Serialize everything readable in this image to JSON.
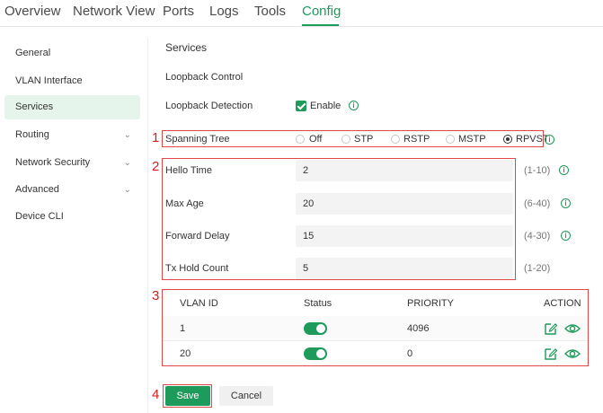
{
  "topnav": {
    "tabs": [
      {
        "label": "Overview"
      },
      {
        "label": "Network View"
      },
      {
        "label": "Ports"
      },
      {
        "label": "Logs"
      },
      {
        "label": "Tools"
      },
      {
        "label": "Config"
      }
    ],
    "active_tab": "Config"
  },
  "sidebar": {
    "items": [
      {
        "label": "General"
      },
      {
        "label": "VLAN Interface"
      },
      {
        "label": "Services"
      },
      {
        "label": "Routing"
      },
      {
        "label": "Network Security"
      },
      {
        "label": "Advanced"
      },
      {
        "label": "Device CLI"
      }
    ],
    "active_item": "Services",
    "expand_icon": "chevron-down-icon"
  },
  "main": {
    "title": "Services",
    "section_title": "Loopback Control",
    "loopback": {
      "label": "Loopback Detection",
      "checkbox_label": "Enable",
      "checked": true
    },
    "spanning_tree": {
      "label": "Spanning Tree",
      "options": [
        "Off",
        "STP",
        "RSTP",
        "MSTP",
        "RPVST"
      ],
      "selected": "RPVST"
    },
    "params": [
      {
        "label": "Hello Time",
        "value": "2",
        "range": "(1-10)",
        "info": true
      },
      {
        "label": "Max Age",
        "value": "20",
        "range": "(6-40)",
        "info": true
      },
      {
        "label": "Forward Delay",
        "value": "15",
        "range": "(4-30)",
        "info": true
      },
      {
        "label": "Tx Hold Count",
        "value": "5",
        "range": "(1-20)",
        "info": false
      }
    ],
    "table": {
      "headers": {
        "vlan_id": "VLAN ID",
        "status": "Status",
        "priority": "PRIORITY",
        "action": "ACTION"
      },
      "rows": [
        {
          "vlan_id": "1",
          "status_on": true,
          "priority": "4096"
        },
        {
          "vlan_id": "20",
          "status_on": true,
          "priority": "0"
        }
      ]
    },
    "buttons": {
      "save": "Save",
      "cancel": "Cancel"
    }
  },
  "annotations": [
    "1",
    "2",
    "3",
    "4"
  ],
  "colors": {
    "accent": "#1e9a5a",
    "annotation": "#d42020"
  }
}
